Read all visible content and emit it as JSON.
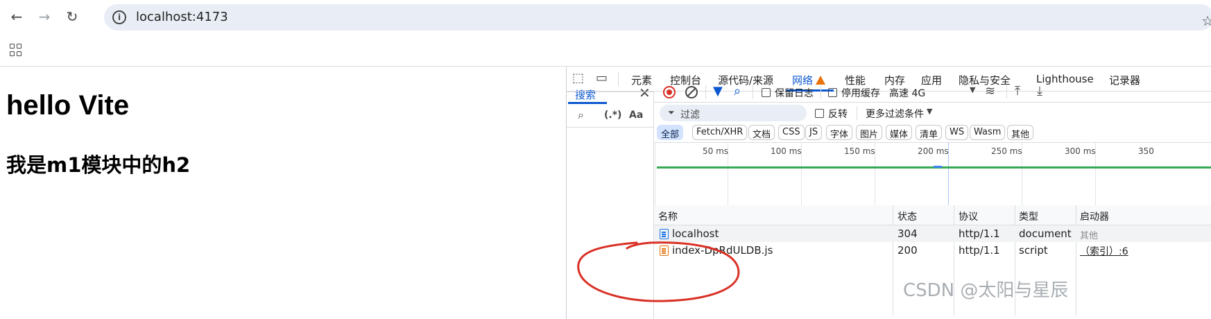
{
  "browser": {
    "url": "localhost:4173"
  },
  "page": {
    "h1": "hello Vite",
    "h2": "我是m1模块中的h2"
  },
  "devtools": {
    "tabs": [
      "元素",
      "控制台",
      "源代码/来源",
      "网络",
      "性能",
      "内存",
      "应用",
      "隐私与安全",
      "Lighthouse",
      "记录器"
    ],
    "active_tab": "网络",
    "search": {
      "tab_label": "搜索",
      "regex_label": "(.*)",
      "case_label": "Aa"
    },
    "toolbar": {
      "preserve_log": "保留日志",
      "disable_cache": "停用缓存",
      "throttle": "高速 4G"
    },
    "filter": {
      "placeholder": "过滤",
      "invert": "反转",
      "more_filters": "更多过滤条件"
    },
    "type_filters": [
      "全部",
      "Fetch/XHR",
      "文档",
      "CSS",
      "JS",
      "字体",
      "图片",
      "媒体",
      "清单",
      "WS",
      "Wasm",
      "其他"
    ],
    "timeline_ticks": [
      "50 ms",
      "100 ms",
      "150 ms",
      "200 ms",
      "250 ms",
      "300 ms",
      "350"
    ],
    "columns": [
      "名称",
      "状态",
      "协议",
      "类型",
      "启动器"
    ],
    "rows": [
      {
        "name": "localhost",
        "status": "304",
        "protocol": "http/1.1",
        "type": "document",
        "initiator": "其他"
      },
      {
        "name": "index-DpRdULDB.js",
        "status": "200",
        "protocol": "http/1.1",
        "type": "script",
        "initiator": "（索引）:6"
      }
    ]
  },
  "watermark": "CSDN @太阳与星辰",
  "colors": {
    "accent": "#0b57d0",
    "annotation": "#d93025"
  }
}
